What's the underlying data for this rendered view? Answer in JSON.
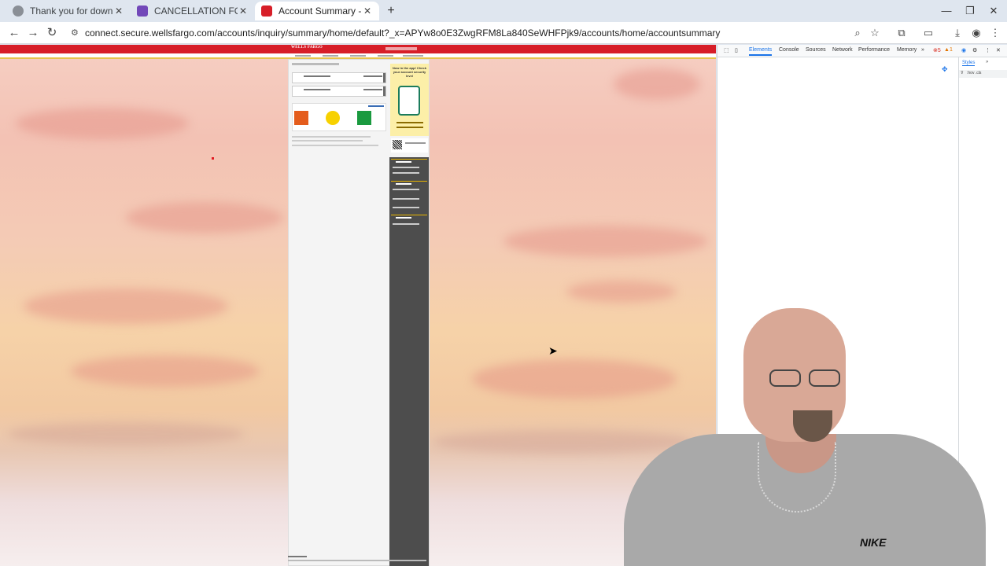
{
  "browser": {
    "tabs": [
      {
        "title": "Thank you for downloading Am",
        "favicon_color": "#5f6368",
        "active": false
      },
      {
        "title": "CANCELLATION FORM",
        "favicon_color": "#7248b9",
        "active": false
      },
      {
        "title": "Account Summary - WF",
        "favicon_color": "#d71e28",
        "active": true
      }
    ],
    "new_tab": "+",
    "window_controls": {
      "minimize": "—",
      "maximize": "❐",
      "close": "✕"
    },
    "url": "connect.secure.wellsfargo.com/accounts/inquiry/summary/home/default?_x=APYw8o0E3ZwgRFM8La840SeWHFPjk9/accounts/home/accountsummary"
  },
  "devtools": {
    "tabs": [
      "Elements",
      "Console",
      "Sources",
      "Network",
      "Performance",
      "Memory"
    ],
    "active_tab": "Elements",
    "more": "»",
    "error_count": "5",
    "warning_count": "1",
    "styles_tab": "Styles",
    "filter_text": ":hov .cls"
  },
  "website": {
    "brand": "WELLS FARGO",
    "promo_title": "Now in the app! Check your account security level"
  },
  "colors": {
    "brand_red": "#d71e28",
    "brand_gold": "#e7c24c",
    "devtools_blue": "#1a73e8"
  }
}
